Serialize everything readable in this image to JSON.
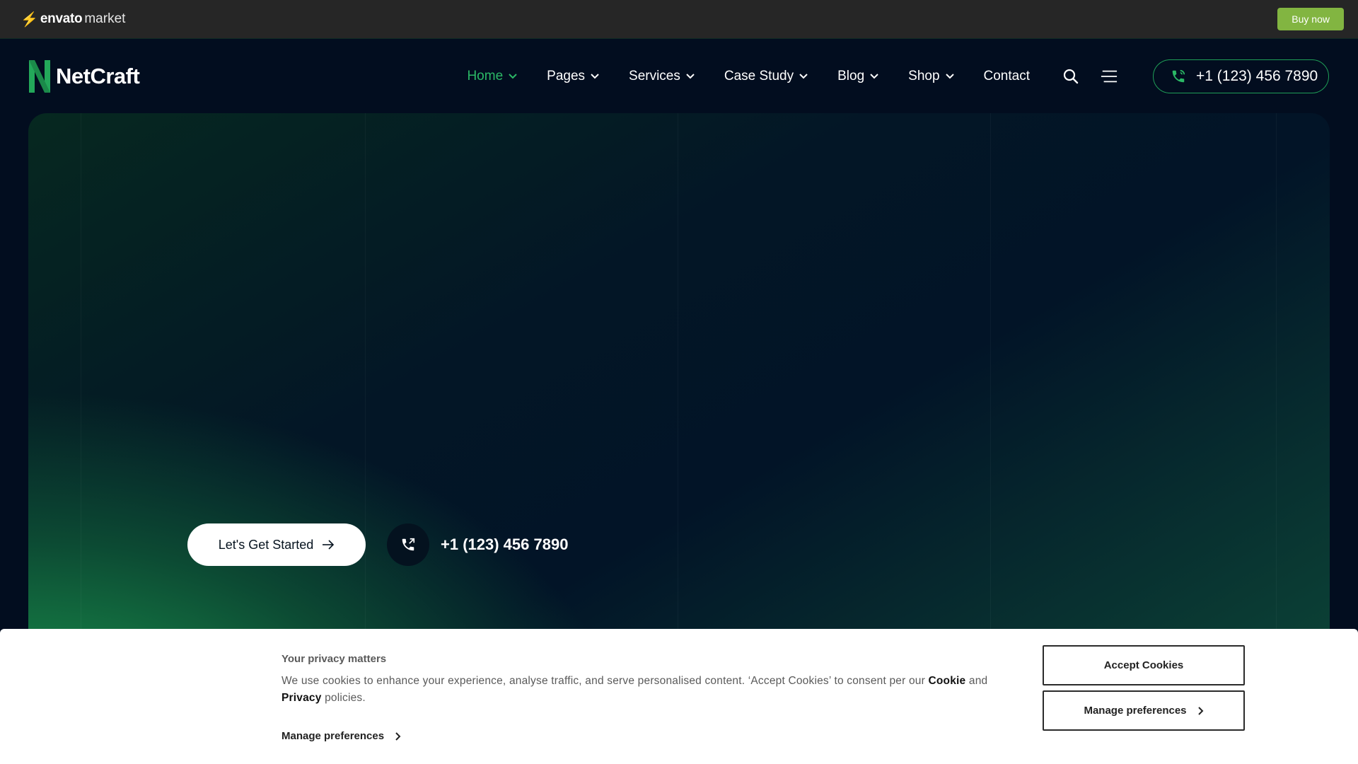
{
  "envato_bar": {
    "brand": "envato",
    "market": "market",
    "buy_now_label": "Buy now"
  },
  "header": {
    "logo_name": "NetCraft",
    "nav": [
      {
        "label": "Home",
        "active": true,
        "dropdown": true
      },
      {
        "label": "Pages",
        "active": false,
        "dropdown": true
      },
      {
        "label": "Services",
        "active": false,
        "dropdown": true
      },
      {
        "label": "Case Study",
        "active": false,
        "dropdown": true
      },
      {
        "label": "Blog",
        "active": false,
        "dropdown": true
      },
      {
        "label": "Shop",
        "active": false,
        "dropdown": true
      },
      {
        "label": "Contact",
        "active": false,
        "dropdown": false
      }
    ],
    "phone": "+1 (123) 456 7890"
  },
  "hero": {
    "cta_label": "Let's Get Started",
    "phone": "+1 (123) 456 7890"
  },
  "cookie": {
    "title": "Your privacy matters",
    "text_before": "We use cookies to enhance your experience, analyse traffic, and serve personalised content. ‘Accept Cookies’ to consent per our ",
    "cookie_word": "Cookie",
    "and_word": " and ",
    "privacy_word": "Privacy",
    "text_after": " policies.",
    "manage_link_label": "Manage preferences",
    "accept_label": "Accept Cookies",
    "manage_button_label": "Manage preferences"
  },
  "colors": {
    "accent_green": "#2bb866",
    "envato_green": "#82b541",
    "page_bg": "#020d1f"
  }
}
